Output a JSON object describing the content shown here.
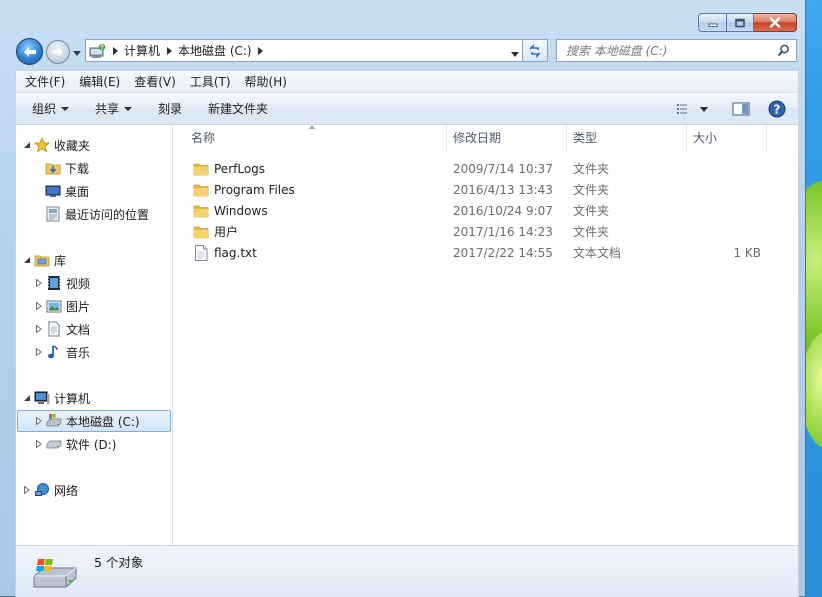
{
  "window": {
    "caption": {
      "minimize": "minimize",
      "maximize": "maximize",
      "close": "close"
    }
  },
  "address": {
    "crumbs": [
      "计算机",
      "本地磁盘 (C:)"
    ]
  },
  "search": {
    "placeholder": "搜索 本地磁盘 (C:)"
  },
  "menu": [
    "文件(F)",
    "编辑(E)",
    "查看(V)",
    "工具(T)",
    "帮助(H)"
  ],
  "commands": {
    "organize": "组织",
    "share": "共享",
    "burn": "刻录",
    "new_folder": "新建文件夹"
  },
  "nav": {
    "favorites": {
      "label": "收藏夹",
      "items": [
        "下载",
        "桌面",
        "最近访问的位置"
      ]
    },
    "libraries": {
      "label": "库",
      "items": [
        "视频",
        "图片",
        "文档",
        "音乐"
      ]
    },
    "computer": {
      "label": "计算机",
      "items": [
        "本地磁盘 (C:)",
        "软件 (D:)"
      ]
    },
    "network": {
      "label": "网络"
    }
  },
  "columns": {
    "name": "名称",
    "date": "修改日期",
    "type": "类型",
    "size": "大小"
  },
  "files": [
    {
      "name": "PerfLogs",
      "date": "2009/7/14 10:37",
      "type": "文件夹",
      "size": "",
      "icon": "folder-icon"
    },
    {
      "name": "Program Files",
      "date": "2016/4/13 13:43",
      "type": "文件夹",
      "size": "",
      "icon": "folder-icon"
    },
    {
      "name": "Windows",
      "date": "2016/10/24 9:07",
      "type": "文件夹",
      "size": "",
      "icon": "folder-icon"
    },
    {
      "name": "用户",
      "date": "2017/1/16 14:23",
      "type": "文件夹",
      "size": "",
      "icon": "folder-icon"
    },
    {
      "name": "flag.txt",
      "date": "2017/2/22 14:55",
      "type": "文本文档",
      "size": "1 KB",
      "icon": "text-file-icon"
    }
  ],
  "details": {
    "count": "5 个对象"
  },
  "colors": {
    "accent": "#2f7fd0",
    "selection": "#d3e6fb",
    "folder": "#f1c75a"
  }
}
